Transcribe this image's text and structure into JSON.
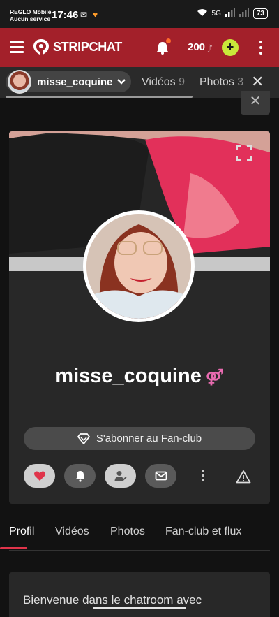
{
  "status_bar": {
    "carrier_line1": "REGLO Mobile",
    "carrier_line2": "Aucun service",
    "time": "17:46",
    "network": "5G",
    "battery": "73"
  },
  "header": {
    "logo_text": "STRIPCHAT",
    "tokens_value": "200",
    "tokens_unit": "jt",
    "add_label": "+",
    "brand_color": "#a3202a",
    "accent_color": "#c9e83a"
  },
  "tabbar": {
    "model_name": "misse_coquine",
    "tabs": [
      {
        "label": "Vidéos",
        "count": "9"
      },
      {
        "label": "Photos",
        "count": "3"
      }
    ],
    "close_symbol": "✕"
  },
  "profile": {
    "username": "misse_coquine",
    "gender_symbol": "⚤",
    "fanclub_label": "S'abonner au Fan-club",
    "actions": [
      "heart-icon",
      "bell-icon",
      "user-check-icon",
      "mail-icon",
      "more-icon",
      "warning-icon"
    ]
  },
  "profile_tabs": [
    {
      "label": "Profil",
      "active": true
    },
    {
      "label": "Vidéos",
      "active": false
    },
    {
      "label": "Photos",
      "active": false
    },
    {
      "label": "Fan-club et flux",
      "active": false
    }
  ],
  "about": {
    "text": "Bienvenue dans le chatroom avec"
  }
}
